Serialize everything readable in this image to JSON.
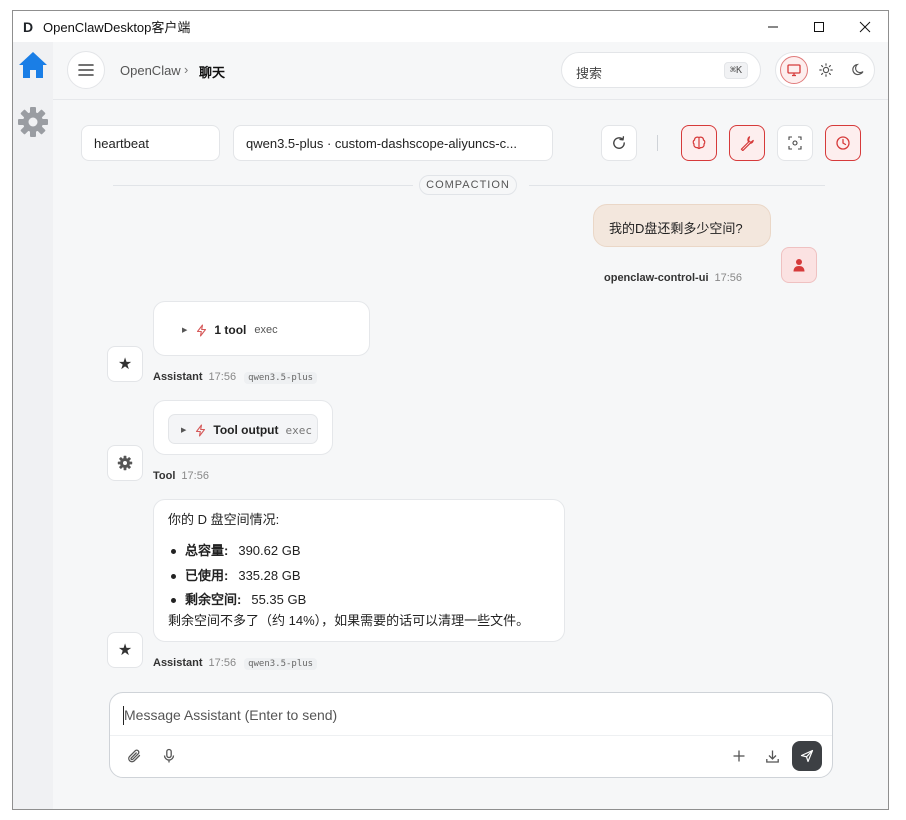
{
  "window": {
    "app_icon": "D",
    "title": "OpenClawDesktop客户端",
    "controls": [
      "minimize-icon",
      "maximize-icon",
      "close-icon"
    ]
  },
  "rail": {
    "items": [
      {
        "icon": "home-icon",
        "active": true,
        "color": "#1a7ee6"
      },
      {
        "icon": "gear-icon",
        "active": false,
        "color": "#9a9da2"
      }
    ]
  },
  "header": {
    "breadcrumb_root": "OpenClaw",
    "breadcrumb_sep": "›",
    "breadcrumb_page": "聊天",
    "search_placeholder": "搜索",
    "search_shortcut": "⌘K",
    "theme_options": [
      "monitor-icon",
      "sun-icon",
      "moon-icon"
    ],
    "theme_active": "monitor-icon"
  },
  "toolbar": {
    "session": "heartbeat",
    "model": "qwen3.5-plus · custom-dashscope-aliyuncs-c...",
    "buttons": [
      "refresh-icon",
      "brain-icon",
      "wrench-icon",
      "focus-icon",
      "clock-icon"
    ]
  },
  "divider": {
    "label": "COMPACTION"
  },
  "messages": [
    {
      "role": "user",
      "text": "我的D盘还剩多少空间?",
      "sender": "openclaw-control-ui",
      "time": "17:56"
    },
    {
      "role": "assistant",
      "tool_count": "1 tool",
      "tool_name": "exec",
      "sender": "Assistant",
      "time": "17:56",
      "model": "qwen3.5-plus"
    },
    {
      "role": "tool",
      "label": "Tool output",
      "tool_name": "exec",
      "sender": "Tool",
      "time": "17:56"
    },
    {
      "role": "assistant",
      "intro": "你的 D 盘空间情况:",
      "items": [
        {
          "label": "总容量:",
          "value": "390.62 GB"
        },
        {
          "label": "已使用:",
          "value": "335.28 GB"
        },
        {
          "label": "剩余空间:",
          "value": "55.35 GB"
        }
      ],
      "outro": "剩余空间不多了（约 14%），如果需要的话可以清理一些文件。",
      "sender": "Assistant",
      "time": "17:56",
      "model": "qwen3.5-plus"
    }
  ],
  "composer": {
    "placeholder": "Message Assistant (Enter to send)",
    "left_buttons": [
      "paperclip-icon",
      "microphone-icon"
    ],
    "right_buttons": [
      "plus-icon",
      "download-icon",
      "send-icon"
    ]
  },
  "colors": {
    "accent_red": "#d63a3a",
    "accent_blue": "#1a7ee6",
    "user_bubble": "#f3e7dd",
    "send_button": "#3d4044"
  }
}
